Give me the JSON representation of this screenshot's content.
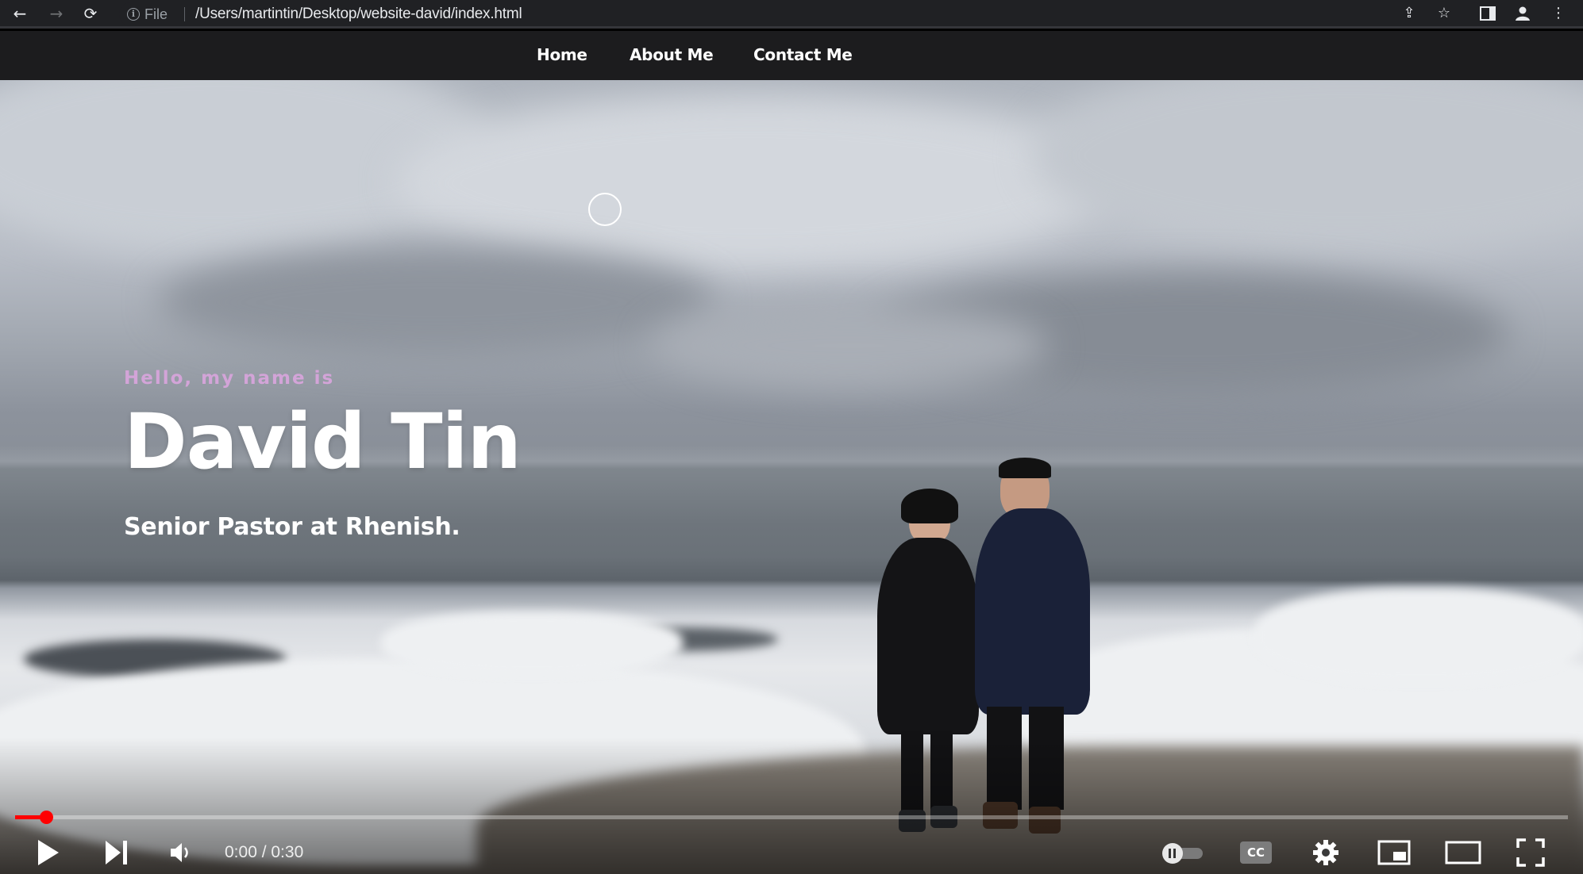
{
  "browser": {
    "file_label": "File",
    "url": "/Users/martintin/Desktop/website-david/index.html",
    "icons": [
      "back-icon",
      "forward-icon",
      "reload-icon",
      "info-icon",
      "share-icon",
      "bookmark-star-icon",
      "side-panel-icon",
      "profile-icon",
      "more-menu-icon"
    ]
  },
  "site_nav": {
    "items": [
      {
        "label": "Home"
      },
      {
        "label": "About Me"
      },
      {
        "label": "Contact Me"
      }
    ]
  },
  "hero": {
    "greeting": "Hello, my name is",
    "name": "David Tin",
    "role": "Senior Pastor at Rhenish."
  },
  "player": {
    "time": "0:00 / 0:30",
    "progress_fraction": 0.02,
    "accent_color": "#ff0000",
    "cc_label": "CC",
    "icons": [
      "play-icon",
      "next-icon",
      "volume-icon",
      "autoplay-toggle-icon",
      "captions-icon",
      "settings-gear-icon",
      "miniplayer-icon",
      "theater-mode-icon",
      "fullscreen-icon"
    ]
  }
}
